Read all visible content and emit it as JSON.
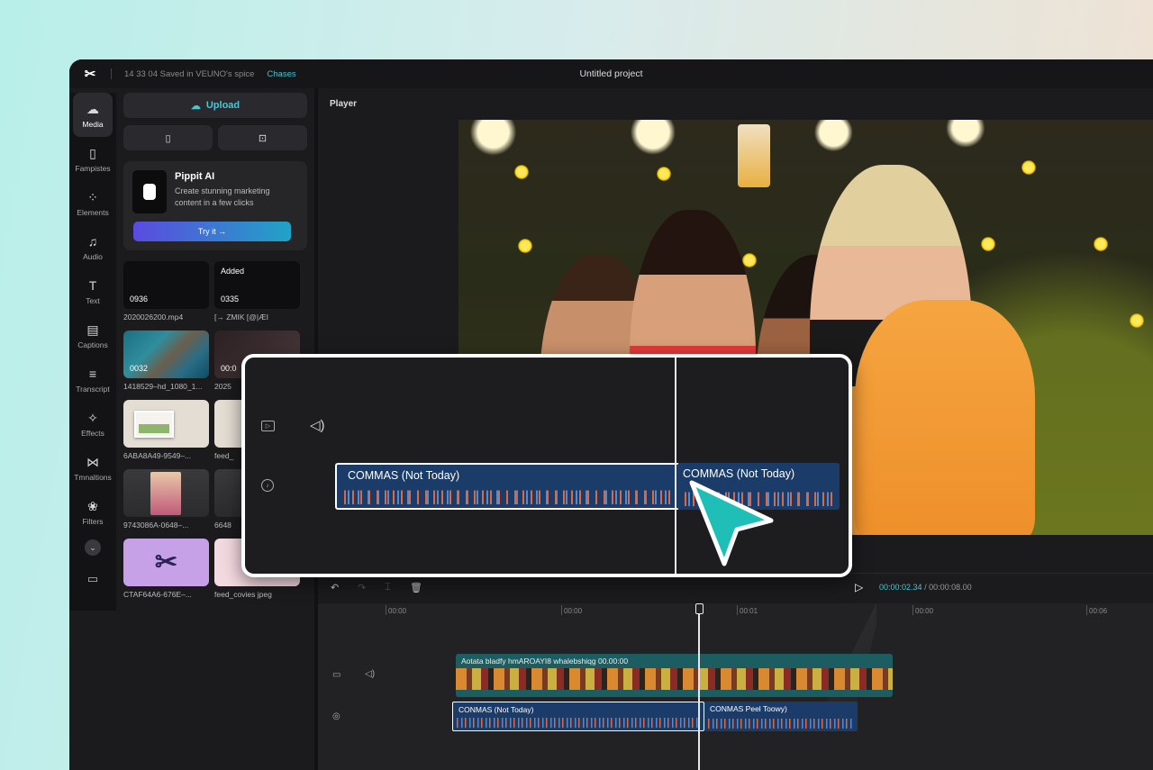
{
  "titlebar": {
    "saved_status": "14 33 04  Saved in VEUNO's spice",
    "changes_link": "Chases",
    "project_name": "Untitled project"
  },
  "sidebar": {
    "items": [
      {
        "label": "Media",
        "icon": "cloud-icon"
      },
      {
        "label": "Fampistes",
        "icon": "templates-icon"
      },
      {
        "label": "Elements",
        "icon": "elements-icon"
      },
      {
        "label": "Audio",
        "icon": "music-icon"
      },
      {
        "label": "Text",
        "icon": "text-icon"
      },
      {
        "label": "Captions",
        "icon": "captions-icon"
      },
      {
        "label": "Transcript",
        "icon": "transcript-icon"
      },
      {
        "label": "Effects",
        "icon": "effects-icon"
      },
      {
        "label": "Tmnaltions",
        "icon": "transitions-icon"
      },
      {
        "label": "Filters",
        "icon": "filters-icon"
      }
    ]
  },
  "media": {
    "upload_label": "Upload",
    "promo": {
      "title": "Pippit AI",
      "description": "Create stunning marketing content in a few clicks",
      "button": "Try it →"
    },
    "items": [
      {
        "caption": "2020026200.mp4",
        "duration": "0936",
        "badge": ""
      },
      {
        "caption": "[→  ZMIK  [@|ÆI",
        "duration": "0335",
        "badge": "Added"
      },
      {
        "caption": "1418529–hd_1080_1...",
        "duration": "0032",
        "badge": ""
      },
      {
        "caption": "2025",
        "duration": "00:0",
        "badge": ""
      },
      {
        "caption": "6ABA8A49-9549–...",
        "duration": "",
        "badge": ""
      },
      {
        "caption": "feed_",
        "duration": "",
        "badge": ""
      },
      {
        "caption": "9743086A-0648–...",
        "duration": "",
        "badge": ""
      },
      {
        "caption": "6648",
        "duration": "",
        "badge": ""
      },
      {
        "caption": "CTAF64A6-676E–...",
        "duration": "",
        "badge": ""
      },
      {
        "caption": "feed_covies jpeg",
        "duration": "",
        "badge": ""
      }
    ]
  },
  "player": {
    "label": "Player"
  },
  "callout": {
    "clip1": "COMMAS (Not Today)",
    "clip2": "COMMAS (Not Today)"
  },
  "toolbar": {
    "current_time": "00:00:02.34",
    "total_time": "/ 00:00:08.00"
  },
  "timeline": {
    "ruler": [
      "00:00",
      "00:00",
      "00:01",
      "00:00",
      "00:06"
    ],
    "video_clip_label": "Aotata bladfy hmAROAYI8 whalebshiqg   00.00:00",
    "audio_clip1_label": "CONMAS (Not Today)",
    "audio_clip2_label": "CONMAS Peel Toowy)"
  },
  "colors": {
    "accent": "#41c8d6",
    "audio_clip": "#1b3b68",
    "video_clip": "#1c5d62",
    "cursor": "#1fbfb8"
  }
}
